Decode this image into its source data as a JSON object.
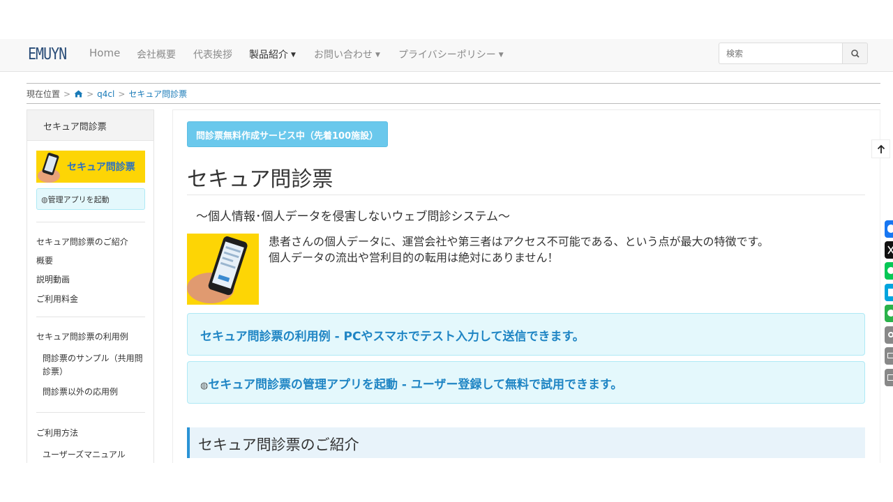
{
  "header": {
    "brand": "EMUYN",
    "nav": [
      {
        "label": "Home",
        "dropdown": false
      },
      {
        "label": "会社概要",
        "dropdown": false
      },
      {
        "label": "代表挨拶",
        "dropdown": false
      },
      {
        "label": "製品紹介",
        "dropdown": true,
        "active": true
      },
      {
        "label": "お問い合わせ",
        "dropdown": true
      },
      {
        "label": "プライバシーポリシー",
        "dropdown": true
      }
    ],
    "search": {
      "placeholder": "検索",
      "icon": "search-icon"
    }
  },
  "breadcrumb": {
    "label": "現在位置",
    "home_icon": "home-icon",
    "items": [
      "q4cl",
      "セキュア問診票"
    ],
    "separator": ">"
  },
  "sidebar": {
    "title": "セキュア問診票",
    "banner_text": "セキュア問診票",
    "app_link": "管理アプリを起動",
    "groups": [
      {
        "items": [
          "セキュア問診票のご紹介",
          "概要",
          "説明動画",
          "ご利用料金"
        ]
      },
      {
        "items": [
          "セキュア問診票の利用例",
          "問診票のサンプル（共用問",
          "診票）",
          "問診票以外の応用例"
        ]
      },
      {
        "items": [
          "ご利用方法",
          "ユーザーズマニュアル"
        ]
      }
    ]
  },
  "main": {
    "badge": "問診票無料作成サービス中（先着100施設）",
    "title": "セキュア問診票",
    "subtitle": "～個人情報･個人データを侵害しないウェブ問診システム～",
    "intro": [
      "患者さんの個人データに、運営会社や第三者はアクセス不可能である、という点が最大の特徴です。",
      "個人データの流出や営利目的の転用は絶対にありません！"
    ],
    "callouts": [
      "セキュア問診票の利用例 - PCやスマホでテスト入力して送信できます。",
      "セキュア問診票の管理アプリを起動 - ユーザー登録して無料で試用できます。"
    ],
    "section_title": "セキュア問診票のご紹介"
  },
  "share_bar": {
    "buttons": [
      {
        "name": "facebook",
        "color": "#1877f2"
      },
      {
        "name": "x",
        "color": "#111111"
      },
      {
        "name": "line",
        "color": "#06c755"
      },
      {
        "name": "hatena",
        "color": "#00a4de"
      },
      {
        "name": "pocket-like",
        "color": "#2ab24a"
      },
      {
        "name": "copy-link",
        "color": "#888888"
      },
      {
        "name": "email",
        "color": "#888888"
      },
      {
        "name": "print",
        "color": "#888888"
      }
    ]
  },
  "colors": {
    "accent": "#1f85c4",
    "callout_bg": "#e4f8fc",
    "badge_bg": "#6ac8ec",
    "banner_yellow": "#fdd505"
  }
}
